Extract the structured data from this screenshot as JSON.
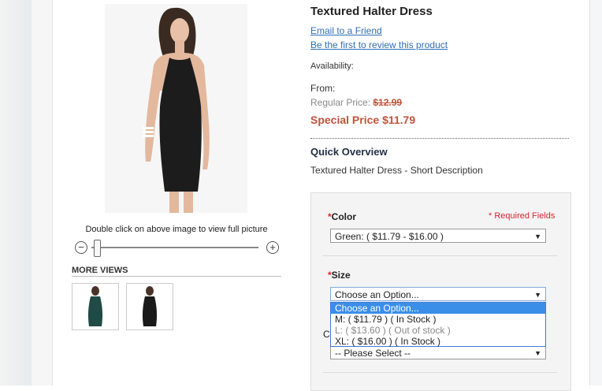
{
  "product": {
    "title": "Textured Halter Dress",
    "email_link": "Email to a Friend",
    "review_link": "Be the first to review this product",
    "availability_label": "Availability:",
    "from_label": "From:",
    "regular_price_label": "Regular Price:",
    "regular_price": "$12.99",
    "special_price_label": "Special Price",
    "special_price": "$11.79"
  },
  "overview": {
    "heading": "Quick Overview",
    "description": "Textured Halter Dress - Short Description"
  },
  "media": {
    "zoom_hint": "Double click on above image to view full picture",
    "zoom_out": "−",
    "zoom_in": "+",
    "zoom_level": 0.05,
    "more_views": "MORE VIEWS",
    "thumbnail_colors": [
      "#1f4a45",
      "#1a1a1a"
    ]
  },
  "options": {
    "required_note": "* Required Fields",
    "color": {
      "label": "Color",
      "value": "Green: ( $11.79 - $16.00 )"
    },
    "size": {
      "label": "Size",
      "value": "Choose an Option...",
      "dropdown": [
        "Choose an Option...",
        "M: ( $11.79 ) ( In Stock )",
        "L: ( $13.60 ) ( Out of stock )",
        "XL: ( $16.00 ) ( In Stock )"
      ]
    },
    "partial_label": "C",
    "third_select": {
      "value": "-- Please Select --"
    }
  },
  "colors": {
    "link": "#2f6fb6",
    "price_accent": "#c0533c",
    "dropdown_highlight": "#3b8ee8"
  }
}
